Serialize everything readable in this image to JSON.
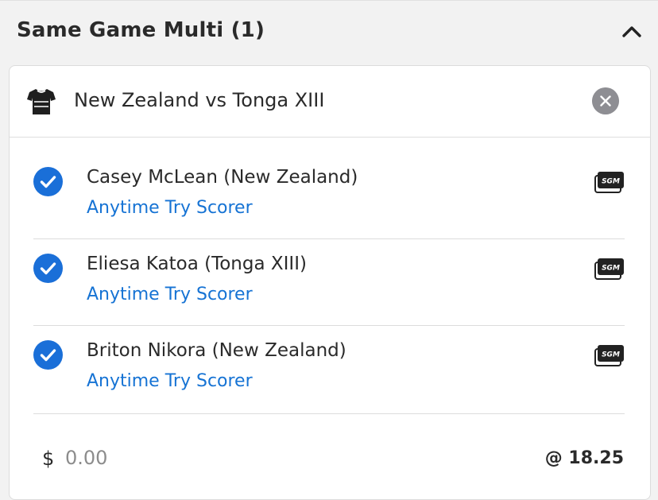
{
  "header": {
    "title": "Same Game Multi (1)",
    "collapse_icon": "chevron-up-icon"
  },
  "event": {
    "title": "New Zealand vs Tonga XIII",
    "sport_icon": "jersey-icon",
    "remove_icon": "close-icon"
  },
  "legs": [
    {
      "selection": "Casey McLean (New Zealand)",
      "market": "Anytime Try Scorer",
      "checked": true,
      "badge": "SGM"
    },
    {
      "selection": "Eliesa Katoa (Tonga XIII)",
      "market": "Anytime Try Scorer",
      "checked": true,
      "badge": "SGM"
    },
    {
      "selection": "Briton Nikora (New Zealand)",
      "market": "Anytime Try Scorer",
      "checked": true,
      "badge": "SGM"
    }
  ],
  "stake": {
    "currency": "$",
    "placeholder": "0.00",
    "value": ""
  },
  "odds": "@ 18.25",
  "colors": {
    "accent_blue": "#1673d4",
    "check_blue": "#1a6fd8",
    "header_bg": "#f2f2f2",
    "remove_grey": "#8e8e93"
  }
}
